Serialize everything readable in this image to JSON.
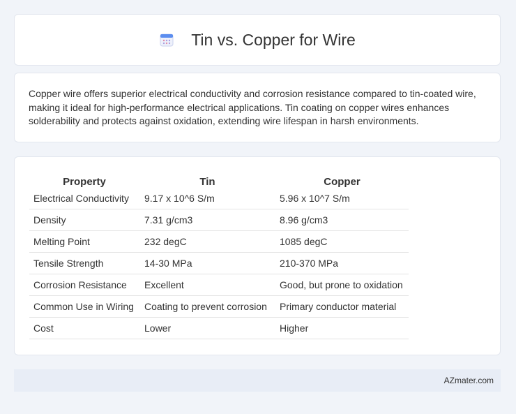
{
  "header": {
    "title": "Tin vs. Copper for Wire",
    "icon": "calendar-icon"
  },
  "summary": {
    "text": "Copper wire offers superior electrical conductivity and corrosion resistance compared to tin-coated wire, making it ideal for high-performance electrical applications. Tin coating on copper wires enhances solderability and protects against oxidation, extending wire lifespan in harsh environments."
  },
  "table": {
    "headers": [
      "Property",
      "Tin",
      "Copper"
    ],
    "rows": [
      [
        "Electrical Conductivity",
        "9.17 x 10^6 S/m",
        "5.96 x 10^7 S/m"
      ],
      [
        "Density",
        "7.31 g/cm3",
        "8.96 g/cm3"
      ],
      [
        "Melting Point",
        "232 degC",
        "1085 degC"
      ],
      [
        "Tensile Strength",
        "14-30 MPa",
        "210-370 MPa"
      ],
      [
        "Corrosion Resistance",
        "Excellent",
        "Good, but prone to oxidation"
      ],
      [
        "Common Use in Wiring",
        "Coating to prevent corrosion",
        "Primary conductor material"
      ],
      [
        "Cost",
        "Lower",
        "Higher"
      ]
    ]
  },
  "footer": {
    "text": "AZmater.com"
  },
  "colors": {
    "background": "#f1f4f9",
    "card": "#ffffff",
    "footer_bg": "#e8edf6",
    "icon_accent": "#5b8def"
  }
}
